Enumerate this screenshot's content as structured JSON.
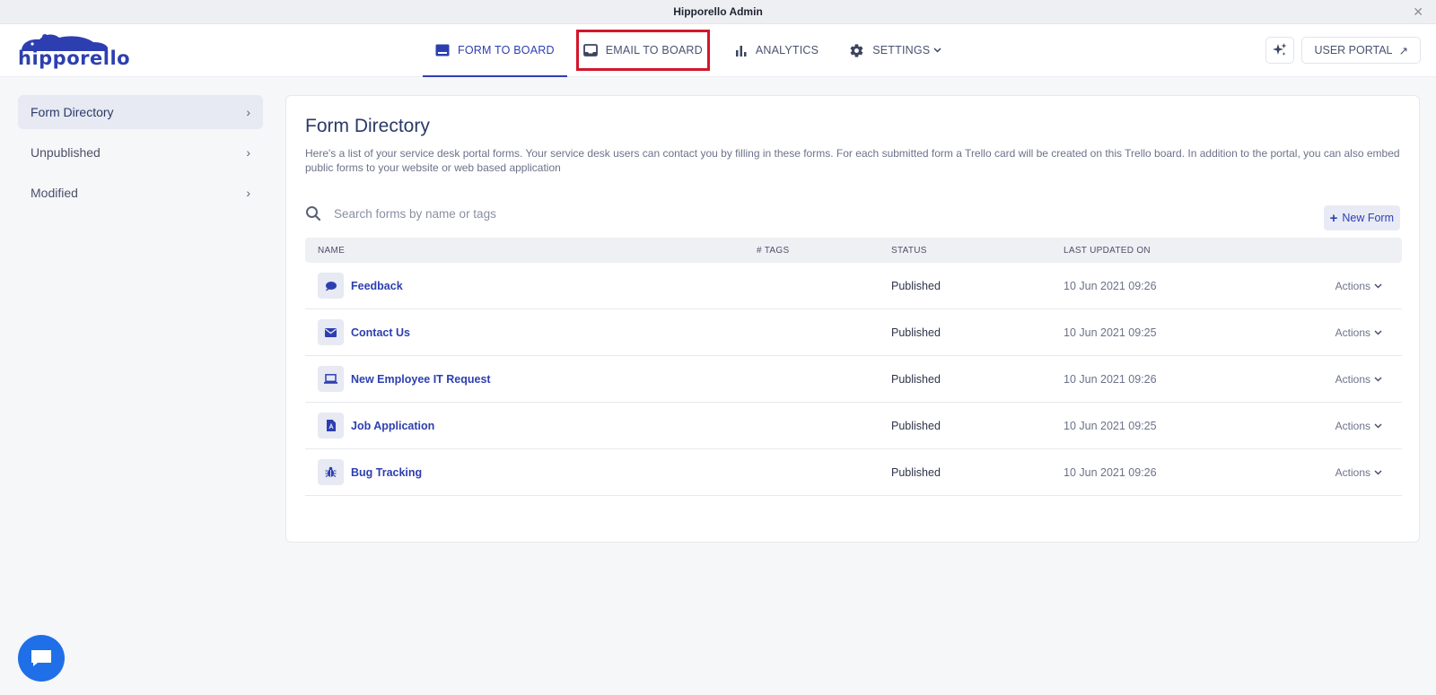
{
  "window": {
    "title": "Hipporello Admin",
    "close_glyph": "✕"
  },
  "brand": {
    "logo_text": "hipporello",
    "color": "#2d3fb0"
  },
  "nav": {
    "tabs": [
      {
        "label": "FORM TO BOARD",
        "icon": "form-board-icon",
        "active": true
      },
      {
        "label": "EMAIL TO BOARD",
        "icon": "inbox-icon",
        "highlighted": true
      },
      {
        "label": "ANALYTICS",
        "icon": "bar-chart-icon"
      },
      {
        "label": "SETTINGS",
        "icon": "gear-icon"
      }
    ],
    "sparkle_icon": "sparkle-icon",
    "user_portal_label": "USER PORTAL",
    "user_portal_glyph": "↗"
  },
  "sidebar": {
    "items": [
      {
        "label": "Form Directory",
        "active": true
      },
      {
        "label": "Unpublished"
      },
      {
        "label": "Modified"
      }
    ],
    "chevron": "›"
  },
  "main": {
    "title": "Form Directory",
    "description": "Here's a list of your service desk portal forms. Your service desk users can contact you by filling in these forms. For each submitted form a Trello card will be created on this Trello board. In addition to the portal, you can also embed public forms to your website or web based application",
    "search_placeholder": "Search forms by name or tags",
    "new_form_label": "New Form",
    "new_form_glyph": "+",
    "columns": {
      "name": "NAME",
      "tags": "# TAGS",
      "status": "STATUS",
      "updated": "LAST UPDATED ON"
    },
    "rows": [
      {
        "name": "Feedback",
        "icon": "chat-bubble-icon",
        "status": "Published",
        "updated": "10 Jun 2021 09:26",
        "actions": "Actions"
      },
      {
        "name": "Contact Us",
        "icon": "envelope-icon",
        "status": "Published",
        "updated": "10 Jun 2021 09:25",
        "actions": "Actions"
      },
      {
        "name": "New Employee IT Request",
        "icon": "laptop-icon",
        "status": "Published",
        "updated": "10 Jun 2021 09:26",
        "actions": "Actions"
      },
      {
        "name": "Job Application",
        "icon": "document-icon",
        "status": "Published",
        "updated": "10 Jun 2021 09:25",
        "actions": "Actions"
      },
      {
        "name": "Bug Tracking",
        "icon": "bug-icon",
        "status": "Published",
        "updated": "10 Jun 2021 09:26",
        "actions": "Actions"
      }
    ]
  },
  "chat": {
    "icon": "chat-icon",
    "color": "#1f6fe8"
  }
}
